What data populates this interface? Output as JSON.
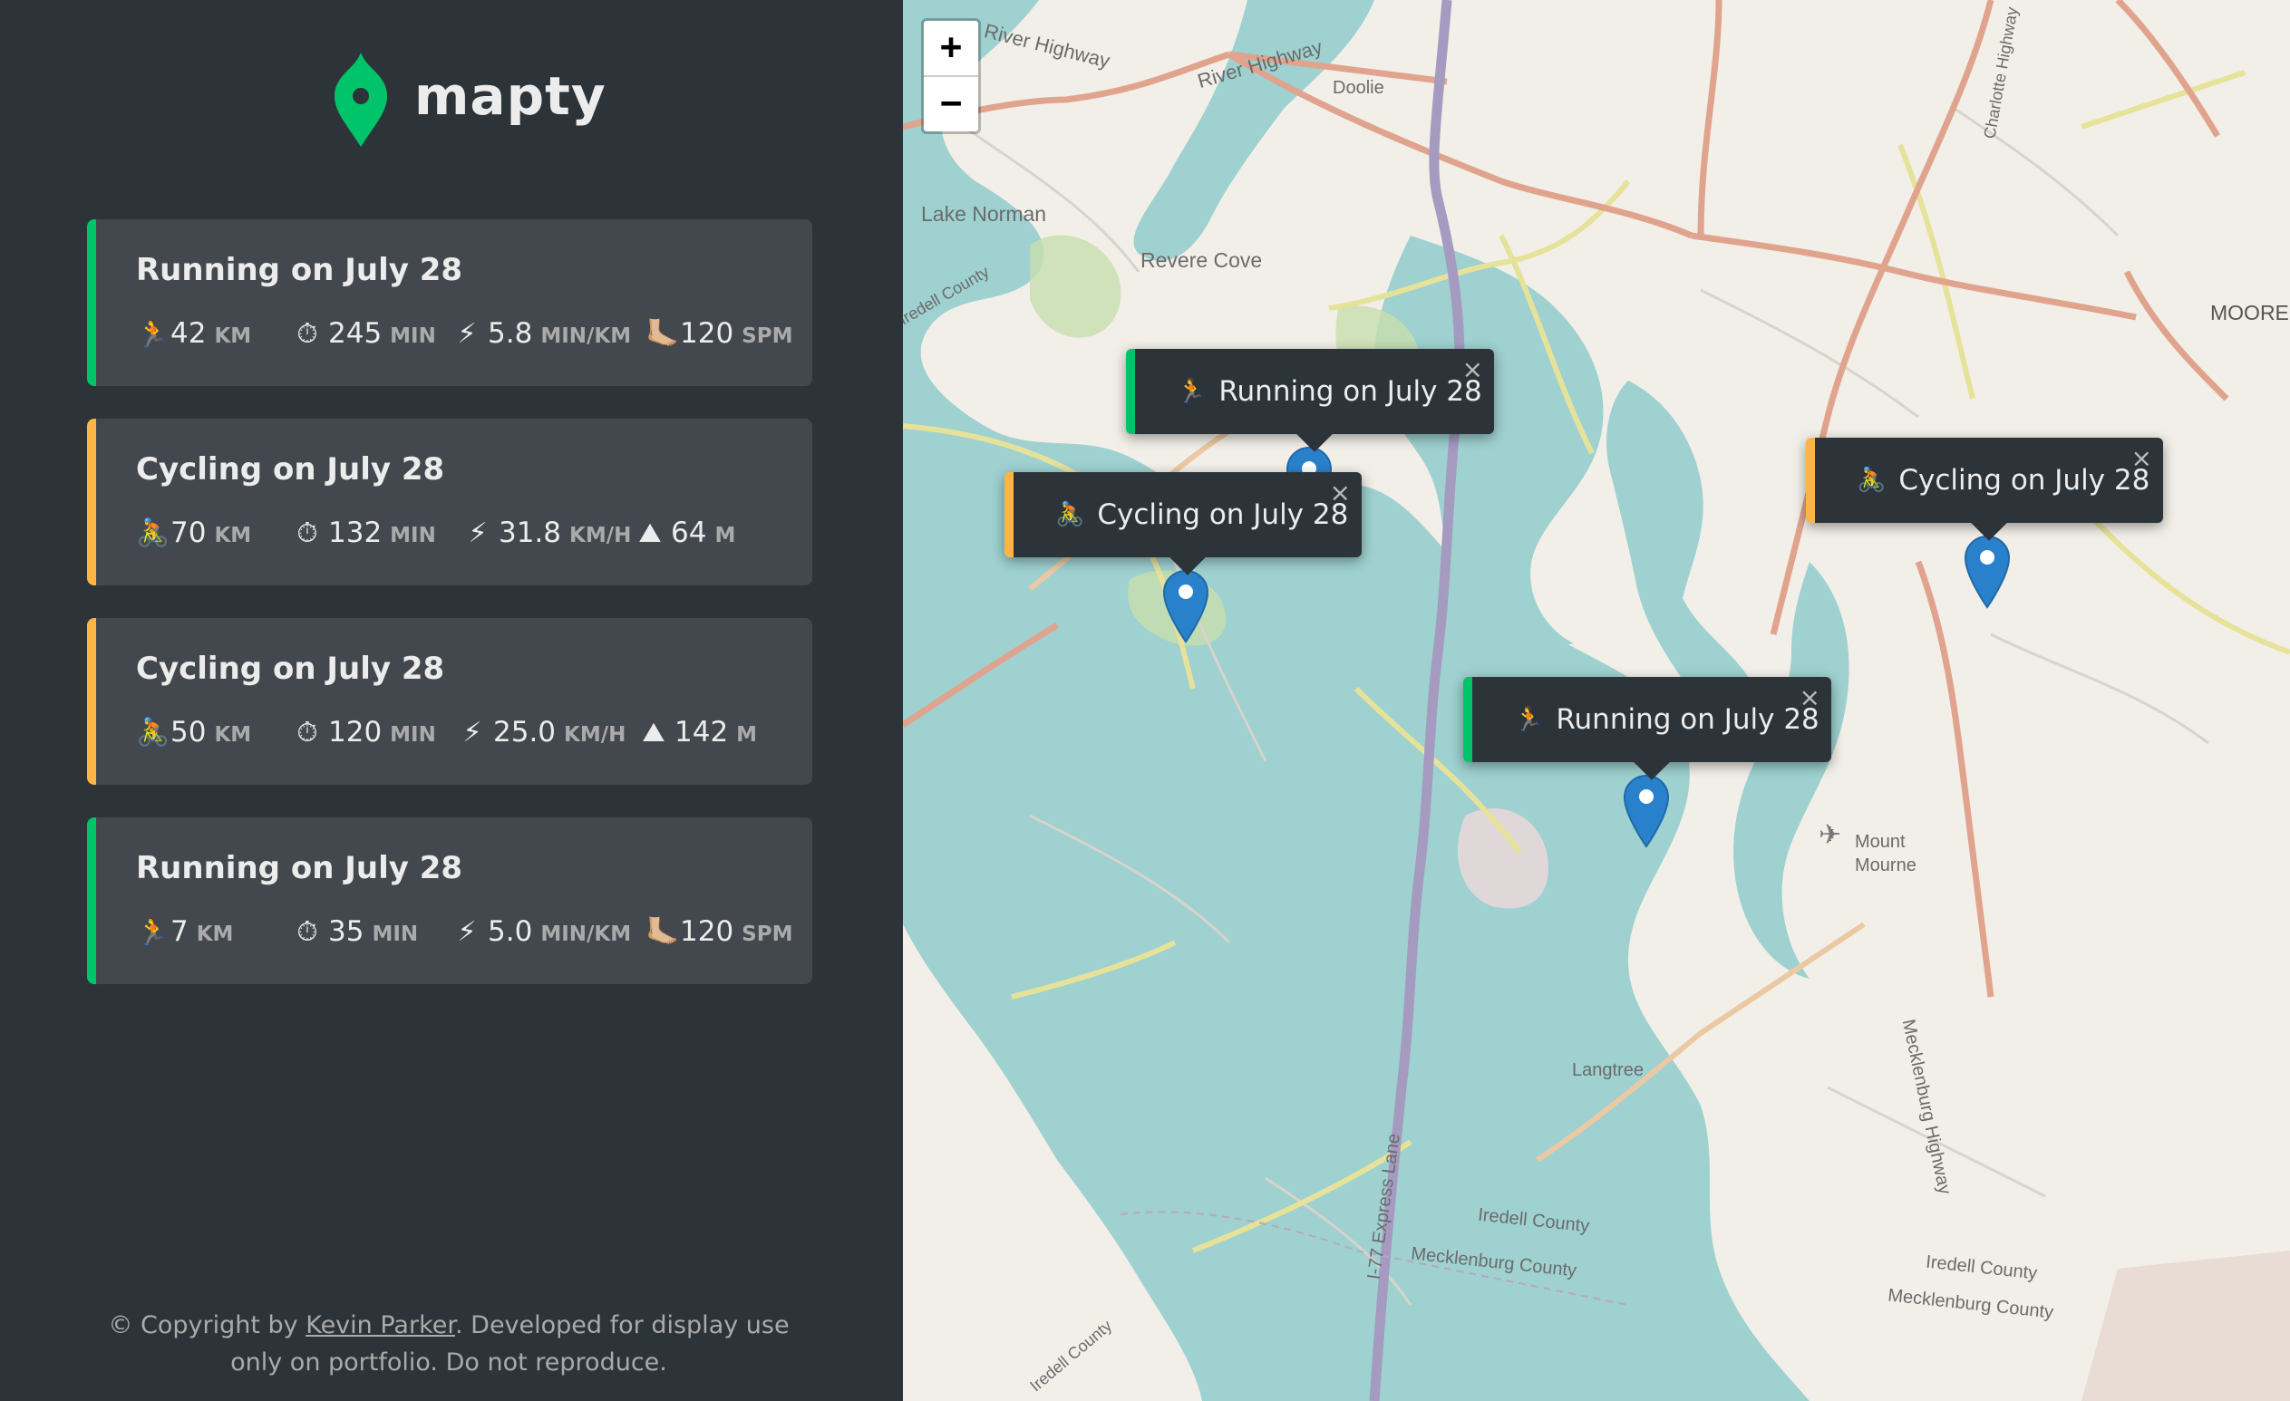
{
  "brand": {
    "name": "mapty",
    "accent": "#00c46a"
  },
  "colors": {
    "running": "#00c46a",
    "cycling": "#ffb545",
    "sidebar_bg": "#2d3439",
    "card_bg": "#42484d"
  },
  "workouts": [
    {
      "type": "running",
      "title": "Running on July 28",
      "details": [
        {
          "icon": "🏃",
          "value": "42",
          "unit": "km"
        },
        {
          "icon": "⏱",
          "value": "245",
          "unit": "min"
        },
        {
          "icon": "⚡",
          "value": "5.8",
          "unit": "min/km"
        },
        {
          "icon": "🦶🏼",
          "value": "120",
          "unit": "spm"
        }
      ]
    },
    {
      "type": "cycling",
      "title": "Cycling on July 28",
      "details": [
        {
          "icon": "🚴",
          "value": "70",
          "unit": "km"
        },
        {
          "icon": "⏱",
          "value": "132",
          "unit": "min"
        },
        {
          "icon": "⚡",
          "value": "31.8",
          "unit": "km/h"
        },
        {
          "icon": "⛰",
          "value": "64",
          "unit": "m"
        }
      ]
    },
    {
      "type": "cycling",
      "title": "Cycling on July 28",
      "details": [
        {
          "icon": "🚴",
          "value": "50",
          "unit": "km"
        },
        {
          "icon": "⏱",
          "value": "120",
          "unit": "min"
        },
        {
          "icon": "⚡",
          "value": "25.0",
          "unit": "km/h"
        },
        {
          "icon": "⛰",
          "value": "142",
          "unit": "m"
        }
      ]
    },
    {
      "type": "running",
      "title": "Running on July 28",
      "details": [
        {
          "icon": "🏃",
          "value": "7",
          "unit": "km"
        },
        {
          "icon": "⏱",
          "value": "35",
          "unit": "min"
        },
        {
          "icon": "⚡",
          "value": "5.0",
          "unit": "min/km"
        },
        {
          "icon": "🦶🏼",
          "value": "120",
          "unit": "spm"
        }
      ]
    }
  ],
  "copyright": {
    "prefix": "© Copyright by ",
    "author": "Kevin Parker",
    "suffix": ". Developed for display use only on portfolio. Do not reproduce."
  },
  "map": {
    "zoom_in": "+",
    "zoom_out": "−",
    "close_glyph": "×",
    "popups": [
      {
        "type": "running",
        "icon": "🏃",
        "label": "Running on July 28"
      },
      {
        "type": "cycling",
        "icon": "🚴",
        "label": "Cycling on July 28"
      },
      {
        "type": "cycling",
        "icon": "🚴",
        "label": "Cycling on July 28"
      },
      {
        "type": "running",
        "icon": "🏃",
        "label": "Running on July 28"
      }
    ],
    "place_labels": {
      "river_hwy_1": "River Highway",
      "river_hwy_2": "River Highway",
      "doolie": "Doolie",
      "lake_norman": "Lake Norman",
      "revere_cove": "Revere Cove",
      "iredell_left": "Iredell County",
      "moore": "MOORE",
      "charlotte_hwy": "Charlotte Highway",
      "mount_mourne": "Mount Mourne",
      "langtree": "Langtree",
      "i77": "I-77 Express Lane",
      "iredell_county_1": "Iredell County",
      "mecklenburg_county_1": "Mecklenburg County",
      "mecklenburg_hwy": "Mecklenburg Highway",
      "iredell_county_2": "Iredell County",
      "mecklenburg_county_2": "Mecklenburg County",
      "iredell_bottom": "Iredell County"
    }
  }
}
